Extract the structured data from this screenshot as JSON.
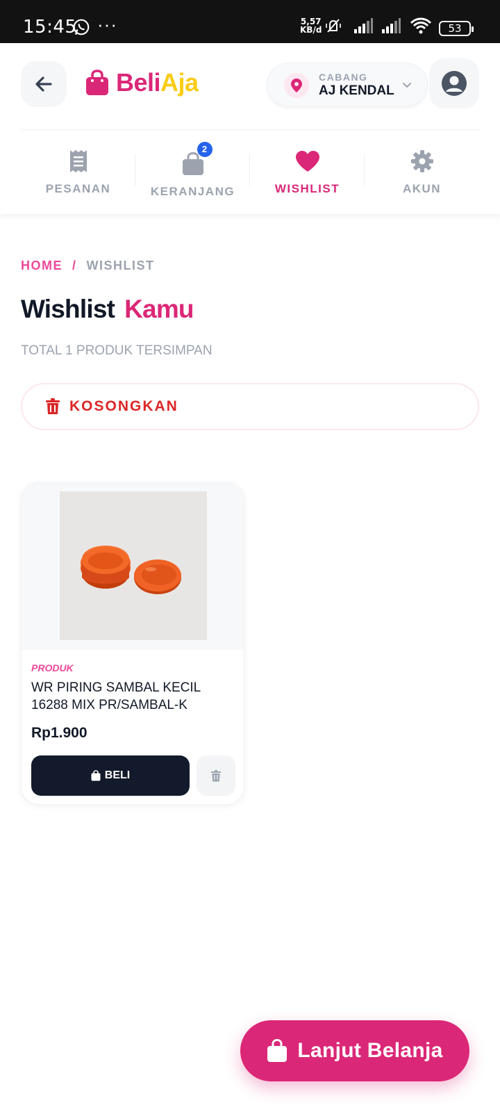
{
  "status_bar": {
    "time": "15:45",
    "net_speed_value": "5,57",
    "net_speed_unit": "KB/d",
    "battery": "53"
  },
  "header": {
    "logo_part1": "Beli",
    "logo_part2": "Aja",
    "branch_label": "CABANG",
    "branch_name": "AJ KENDAL"
  },
  "nav": {
    "items": [
      {
        "label": "PESANAN",
        "icon": "receipt-icon"
      },
      {
        "label": "KERANJANG",
        "icon": "shopping-bag-icon",
        "badge": "2"
      },
      {
        "label": "WISHLIST",
        "icon": "heart-icon",
        "active": true
      },
      {
        "label": "AKUN",
        "icon": "gear-icon"
      }
    ]
  },
  "breadcrumb": {
    "home": "HOME",
    "separator": "/",
    "current": "WISHLIST"
  },
  "page": {
    "title_part1": "Wishlist",
    "title_part2": "Kamu",
    "subtitle": "TOTAL 1 PRODUK TERSIMPAN",
    "clear_label": "KOSONGKAN"
  },
  "products": [
    {
      "category": "PRODUK",
      "name": "WR PIRING SAMBAL KECIL 16288 MIX PR/SAMBAL-K",
      "price": "Rp1.900",
      "buy_label": "BELI"
    }
  ],
  "fab": {
    "label": "Lanjut Belanja"
  },
  "colors": {
    "brand_pink": "#db2777",
    "brand_yellow": "#facc15",
    "dark_button": "#121a2b",
    "danger": "#dc2626",
    "badge_blue": "#2563eb"
  }
}
